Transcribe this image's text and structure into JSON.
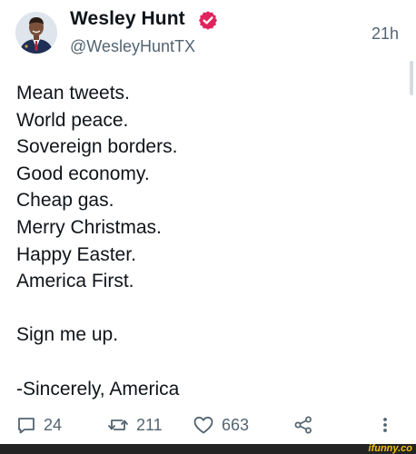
{
  "post": {
    "author": {
      "name": "Wesley Hunt",
      "handle": "@WesleyHuntTX",
      "verified_icon": "verified-badge-icon",
      "verified_color": "#e0245e"
    },
    "timestamp": "21h",
    "body_lines": [
      "Mean tweets.",
      "World peace.",
      "Sovereign borders.",
      "Good economy.",
      "Cheap gas.",
      "Merry Christmas.",
      "Happy Easter.",
      "America First.",
      "",
      "Sign me up.",
      "",
      "-Sincerely, America"
    ],
    "actions": {
      "reply": {
        "icon": "reply-icon",
        "count": "24"
      },
      "repost": {
        "icon": "repost-icon",
        "count": "211"
      },
      "like": {
        "icon": "heart-icon",
        "count": "663"
      },
      "share": {
        "icon": "share-icon"
      },
      "more": {
        "icon": "more-vertical-icon"
      }
    }
  },
  "watermark": {
    "text": "ifunny.co",
    "color": "#f2c200"
  },
  "colors": {
    "text": "#0f1419",
    "muted": "#536471",
    "background": "#ffffff"
  }
}
